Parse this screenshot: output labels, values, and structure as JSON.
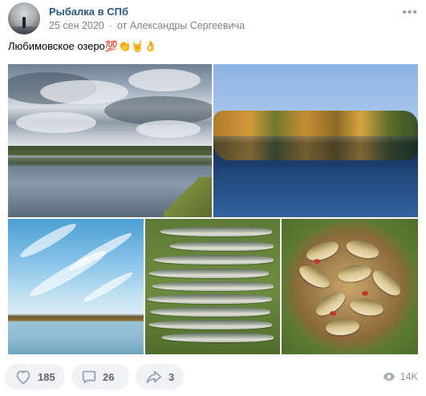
{
  "post": {
    "group_name": "Рыбалка в СПб",
    "date": "25 сен 2020",
    "author": "от Александры Сергеевича",
    "more_icon": "ellipsis-icon",
    "text": "Любимовское озеро",
    "emojis": "💯👏🤘👌"
  },
  "photos": [
    {
      "alt": "cloudy-lake"
    },
    {
      "alt": "autumn-reflection"
    },
    {
      "alt": "blue-sky-lake"
    },
    {
      "alt": "pike-catch"
    },
    {
      "alt": "fish-in-net"
    }
  ],
  "footer": {
    "likes": "185",
    "comments": "26",
    "shares": "3",
    "views": "14K",
    "like_icon": "heart-icon",
    "comment_icon": "comment-icon",
    "share_icon": "share-icon",
    "views_icon": "eye-icon"
  },
  "colors": {
    "link": "#2a5885",
    "meta": "#828282",
    "pill_bg": "#f0f2f5",
    "icon": "#99a2ad"
  }
}
